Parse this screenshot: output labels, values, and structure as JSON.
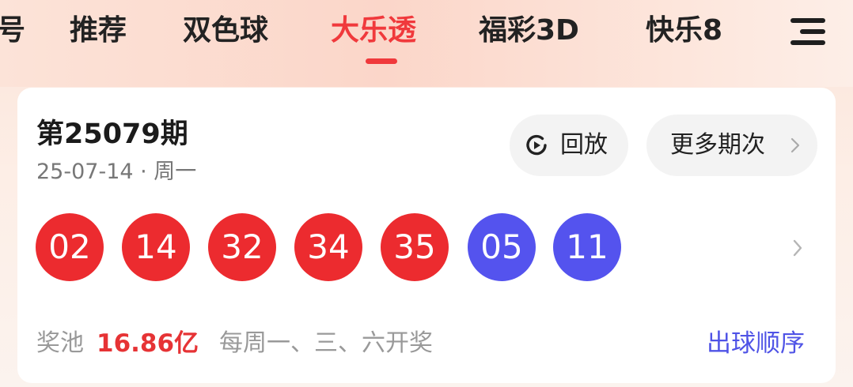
{
  "tabs": [
    {
      "label": "号"
    },
    {
      "label": "推荐"
    },
    {
      "label": "双色球"
    },
    {
      "label": "大乐透",
      "active": true
    },
    {
      "label": "福彩3D"
    },
    {
      "label": "快乐8"
    }
  ],
  "menu_icon": "hamburger-menu-icon",
  "card": {
    "issue": "第25079期",
    "date": "25-07-14 · 周一",
    "replay_label": "回放",
    "more_label": "更多期次",
    "balls": [
      {
        "value": "02",
        "color": "red"
      },
      {
        "value": "14",
        "color": "red"
      },
      {
        "value": "32",
        "color": "red"
      },
      {
        "value": "34",
        "color": "red"
      },
      {
        "value": "35",
        "color": "red"
      },
      {
        "value": "05",
        "color": "blue"
      },
      {
        "value": "11",
        "color": "blue"
      }
    ],
    "pool_label": "奖池",
    "pool_amount": "16.86亿",
    "schedule": "每周一、三、六开奖",
    "order_link": "出球顺序"
  },
  "colors": {
    "accent_red": "#f0393c",
    "front_ball": "#ec2b2f",
    "back_ball": "#5453ee",
    "link_blue": "#4f53e6"
  }
}
